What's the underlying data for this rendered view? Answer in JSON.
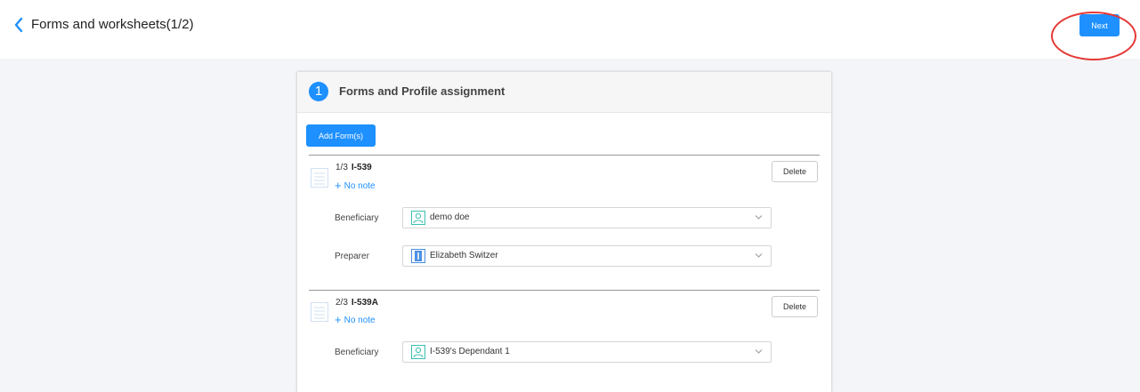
{
  "header": {
    "title": "Forms and worksheets(1/2)",
    "next_label": "Next"
  },
  "card": {
    "step_number": "1",
    "title": "Forms and Profile assignment",
    "add_label": "Add Form(s)"
  },
  "forms": [
    {
      "position": "1/3",
      "code": "I-539",
      "note_label": "No note",
      "delete_label": "Delete",
      "beneficiary_label": "Beneficiary",
      "beneficiary_value": "demo doe",
      "preparer_label": "Preparer",
      "preparer_value": "Elizabeth Switzer"
    },
    {
      "position": "2/3",
      "code": "I-539A",
      "note_label": "No note",
      "delete_label": "Delete",
      "beneficiary_label": "Beneficiary",
      "beneficiary_value": "I-539's Dependant 1"
    }
  ],
  "icons": {
    "back": "chevron-left-icon",
    "form": "form-document-icon",
    "beneficiary": "person-icon",
    "preparer": "preparer-badge-icon",
    "dropdown": "chevron-down-icon"
  },
  "colors": {
    "accent": "#1e90ff",
    "annotation": "#e53935"
  }
}
